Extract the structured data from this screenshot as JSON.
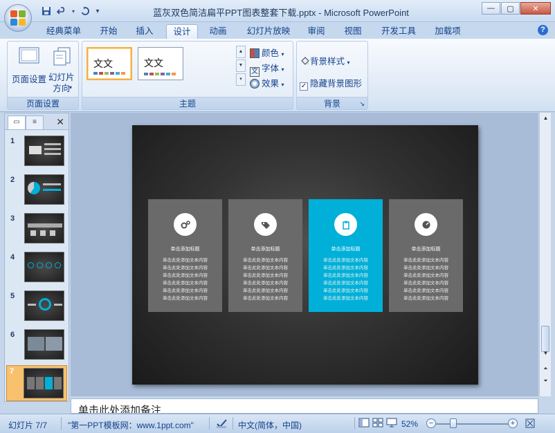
{
  "window": {
    "title": "蓝灰双色简洁扁平PPT图表整套下载.pptx - Microsoft PowerPoint",
    "minimize_glyph": "—",
    "maximize_glyph": "▢",
    "close_glyph": "✕"
  },
  "qat": {
    "save_icon": "save-icon",
    "undo_icon": "undo-icon",
    "redo_icon": "redo-icon",
    "customize_glyph": "▾"
  },
  "tabs": [
    {
      "label": "经典菜单"
    },
    {
      "label": "开始"
    },
    {
      "label": "插入"
    },
    {
      "label": "设计"
    },
    {
      "label": "动画"
    },
    {
      "label": "幻灯片放映"
    },
    {
      "label": "审阅"
    },
    {
      "label": "视图"
    },
    {
      "label": "开发工具"
    },
    {
      "label": "加载项"
    }
  ],
  "help_glyph": "?",
  "ribbon": {
    "page_setup": {
      "label": "页面设置",
      "page_setup_btn": "页面设置",
      "orientation_btn": "幻灯片\n方向"
    },
    "themes": {
      "label": "主题",
      "thumb_text": "文文",
      "colors_btn": "颜色",
      "fonts_btn": "字体",
      "effects_btn": "效果"
    },
    "background": {
      "label": "背景",
      "bg_styles_btn": "背景样式",
      "hide_bg_graphics": "隐藏背景图形",
      "hide_bg_checked": true
    }
  },
  "slides_panel": {
    "close_glyph": "✕",
    "slides": [
      {
        "num": "1"
      },
      {
        "num": "2"
      },
      {
        "num": "3"
      },
      {
        "num": "4"
      },
      {
        "num": "5"
      },
      {
        "num": "6"
      },
      {
        "num": "7",
        "selected": true
      }
    ]
  },
  "slide": {
    "cards": [
      {
        "title": "单击添加标题",
        "lines": [
          "单击此处添加文本内容",
          "单击此处添加文本内容",
          "单击此处添加文本内容",
          "单击此处添加文本内容",
          "单击此处添加文本内容",
          "单击此处添加文本内容"
        ],
        "icon": "gears-icon",
        "highlight": false
      },
      {
        "title": "单击添加标题",
        "lines": [
          "单击此处添加文本内容",
          "单击此处添加文本内容",
          "单击此处添加文本内容",
          "单击此处添加文本内容",
          "单击此处添加文本内容",
          "单击此处添加文本内容"
        ],
        "icon": "tag-icon",
        "highlight": false
      },
      {
        "title": "单击添加标题",
        "lines": [
          "单击此处添加文本内容",
          "单击此处添加文本内容",
          "单击此处添加文本内容",
          "单击此处添加文本内容",
          "单击此处添加文本内容",
          "单击此处添加文本内容"
        ],
        "icon": "clipboard-icon",
        "highlight": true
      },
      {
        "title": "单击添加标题",
        "lines": [
          "单击此处添加文本内容",
          "单击此处添加文本内容",
          "单击此处添加文本内容",
          "单击此处添加文本内容",
          "单击此处添加文本内容",
          "单击此处添加文本内容"
        ],
        "icon": "gauge-icon",
        "highlight": false
      }
    ],
    "accent_color": "#00b0d8",
    "card_color": "#6a6a6a"
  },
  "notes_placeholder": "单击此处添加备注",
  "statusbar": {
    "slide_info": "幻灯片 7/7",
    "theme_name": "\"第一PPT模板网：www.1ppt.com\"",
    "language": "中文(简体，中国)",
    "zoom": "52%",
    "zoom_fraction": 0.52
  }
}
